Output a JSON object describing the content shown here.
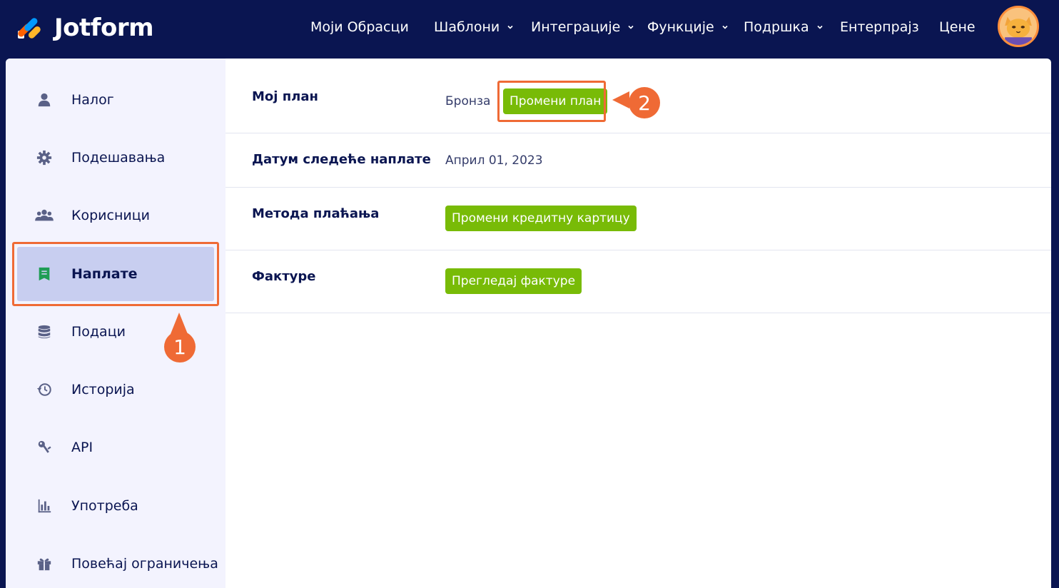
{
  "brand": {
    "name": "Jotform"
  },
  "nav": {
    "items": [
      {
        "label": "Моји Обрасци",
        "has_dropdown": false
      },
      {
        "label": "Шаблони",
        "has_dropdown": true
      },
      {
        "label": "Интеграције",
        "has_dropdown": true
      },
      {
        "label": "Функције",
        "has_dropdown": true
      },
      {
        "label": "Подршка",
        "has_dropdown": true
      },
      {
        "label": "Ентерпрајз",
        "has_dropdown": false
      },
      {
        "label": "Цене",
        "has_dropdown": false
      }
    ]
  },
  "sidebar": {
    "items": [
      {
        "label": "Налог",
        "icon": "user-icon",
        "active": false
      },
      {
        "label": "Подешавања",
        "icon": "gear-icon",
        "active": false
      },
      {
        "label": "Корисници",
        "icon": "users-icon",
        "active": false
      },
      {
        "label": "Наплате",
        "icon": "receipt-icon",
        "active": true
      },
      {
        "label": "Подаци",
        "icon": "database-icon",
        "active": false
      },
      {
        "label": "Историја",
        "icon": "history-icon",
        "active": false
      },
      {
        "label": "API",
        "icon": "key-icon",
        "active": false
      },
      {
        "label": "Употреба",
        "icon": "bar-chart-icon",
        "active": false
      },
      {
        "label": "Повећај ограничења",
        "icon": "gift-icon",
        "active": false
      }
    ]
  },
  "billing": {
    "plan": {
      "label": "Мој план",
      "value": "Бронза",
      "button": "Промени план"
    },
    "next_billing": {
      "label": "Датум следеће наплате",
      "value": "Април 01, 2023"
    },
    "payment_method": {
      "label": "Метода плаћања",
      "button": "Промени кредитну картицу"
    },
    "invoices": {
      "label": "Фактуре",
      "button": "Прегледај фактуре"
    }
  },
  "callouts": {
    "first": "1",
    "second": "2"
  },
  "colors": {
    "nav_bg": "#0a1551",
    "accent_orange": "#ef6a35",
    "button_green": "#78bb07",
    "sidebar_bg": "#f3f3fe",
    "sidebar_active": "#c8cef0"
  }
}
